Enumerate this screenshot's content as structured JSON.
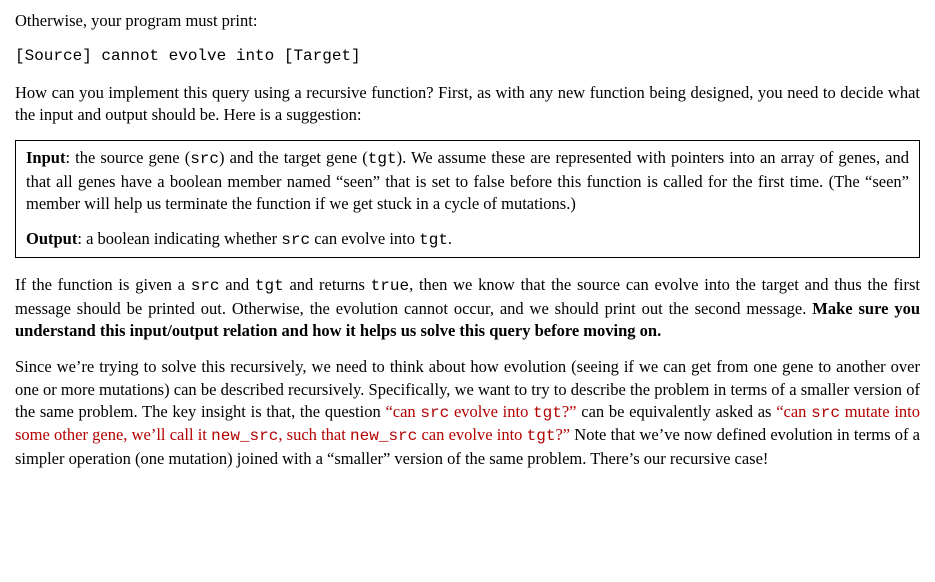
{
  "p_otherwise": "Otherwise, your program must print:",
  "code_cannot": "[Source] cannot evolve into [Target]",
  "p_howcan_1": "How can you implement this query using a recursive function? First, as with any new function being designed, you need to decide what the input and output should be. Here is a suggestion:",
  "box_input_label": "Input",
  "box_input_1": ": the source gene (",
  "box_input_src": "src",
  "box_input_2": ") and the target gene (",
  "box_input_tgt": "tgt",
  "box_input_3": "). We assume these are represented with pointers into an array of genes, and that all genes have a boolean member named “seen” that is set to false before this function is called for the first time. (The “seen” member will help us terminate the function if we get stuck in a cycle of mutations.)",
  "box_output_label": "Output",
  "box_output_1": ": a boolean indicating whether ",
  "box_output_src": "src",
  "box_output_2": " can evolve into ",
  "box_output_tgt": "tgt",
  "box_output_3": ".",
  "p_if_1": "If the function is given a ",
  "p_if_src": "src",
  "p_if_2": " and ",
  "p_if_tgt": "tgt",
  "p_if_3": " and returns ",
  "p_if_true": "true",
  "p_if_4": ", then we know that the source can evolve into the target and thus the first message should be printed out. Otherwise, the evolution cannot occur, and we should print out the second message. ",
  "p_if_bold": "Make sure you understand this input/output relation and how it helps us solve this query before moving on.",
  "p_since_1": "Since we’re trying to solve this recursively, we need to think about how evolution (seeing if we can get from one gene to another over one or more mutations) can be described recursively. Specifically, we want to try to describe the problem in terms of a smaller version of the same problem. The key insight is that, the question ",
  "p_since_red1a": "“can ",
  "p_since_red1_src": "src",
  "p_since_red1b": " evolve into ",
  "p_since_red1_tgt": "tgt",
  "p_since_red1c": "?”",
  "p_since_2": " can be equivalently asked as ",
  "p_since_red2a": "“can ",
  "p_since_red2_src": "src",
  "p_since_red2b": " mutate into some other gene, we’ll call it ",
  "p_since_red2_newsrc": "new_src",
  "p_since_red2c": ", such that ",
  "p_since_red2_newsrc2": "new_src",
  "p_since_red2d": " can evolve into ",
  "p_since_red2_tgt": "tgt",
  "p_since_red2e": "?”",
  "p_since_3": " Note that we’ve now defined evolution in terms of a simpler operation (one mutation) joined with a “smaller” version of the same problem. There’s our recursive case!"
}
